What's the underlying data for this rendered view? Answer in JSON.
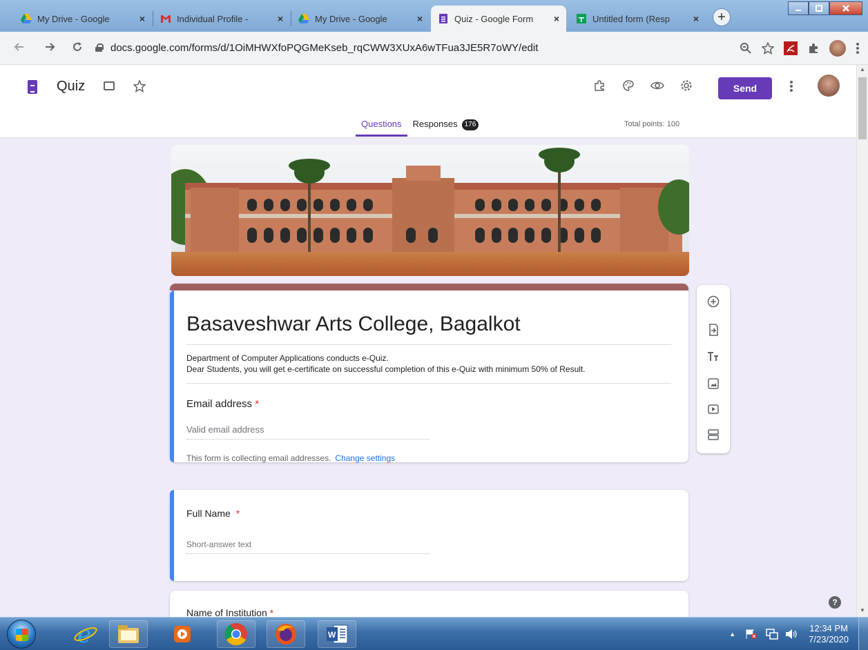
{
  "browser": {
    "tabs": [
      {
        "title": "My Drive - Google",
        "icon": "google-drive-icon",
        "active": false
      },
      {
        "title": "Individual Profile -",
        "icon": "gmail-icon",
        "active": false
      },
      {
        "title": "My Drive - Google",
        "icon": "google-drive-icon",
        "active": false
      },
      {
        "title": "Quiz - Google Form",
        "icon": "google-forms-icon",
        "active": true
      },
      {
        "title": "Untitled form (Resp",
        "icon": "google-sheets-icon",
        "active": false
      }
    ],
    "close_glyph": "×",
    "new_tab_glyph": "+",
    "url": "docs.google.com/forms/d/1OiMHWXfoPQGMeKseb_rqCWW3XUxA6wTFua3JE5R7oWY/edit"
  },
  "forms_header": {
    "doc_title": "Quiz",
    "send_label": "Send",
    "tabs": [
      {
        "label": "Questions",
        "active": true
      },
      {
        "label": "Responses",
        "badge": "176",
        "active": false
      }
    ],
    "total_points": "Total points: 100"
  },
  "form": {
    "title": "Basaveshwar Arts College, Bagalkot",
    "description_line1": "Department of Computer Applications conducts e-Quiz.",
    "description_line2": "Dear Students, you will get e-certificate on successful completion of this e-Quiz with minimum 50% of  Result.",
    "email_question": {
      "label": "Email address",
      "required_mark": "*",
      "placeholder": "Valid email address"
    },
    "collect_note": "This form is collecting email addresses.",
    "change_settings": "Change settings",
    "questions": [
      {
        "label": "Full Name",
        "required_mark": "*",
        "placeholder": "Short-answer text"
      },
      {
        "label": "Name of Institution",
        "required_mark": "*"
      }
    ]
  },
  "taskbar": {
    "time": "12:34 PM",
    "date": "7/23/2020",
    "apps": [
      "windows-start",
      "internet-explorer",
      "file-explorer",
      "media-player",
      "chrome",
      "firefox",
      "word"
    ]
  },
  "colors": {
    "forms_purple": "#673ab7",
    "page_bg": "#f0ebf8",
    "title_accent": "#a06060",
    "selected_bar": "#4285f4",
    "required_red": "#d93025",
    "link_blue": "#1a73e8"
  }
}
